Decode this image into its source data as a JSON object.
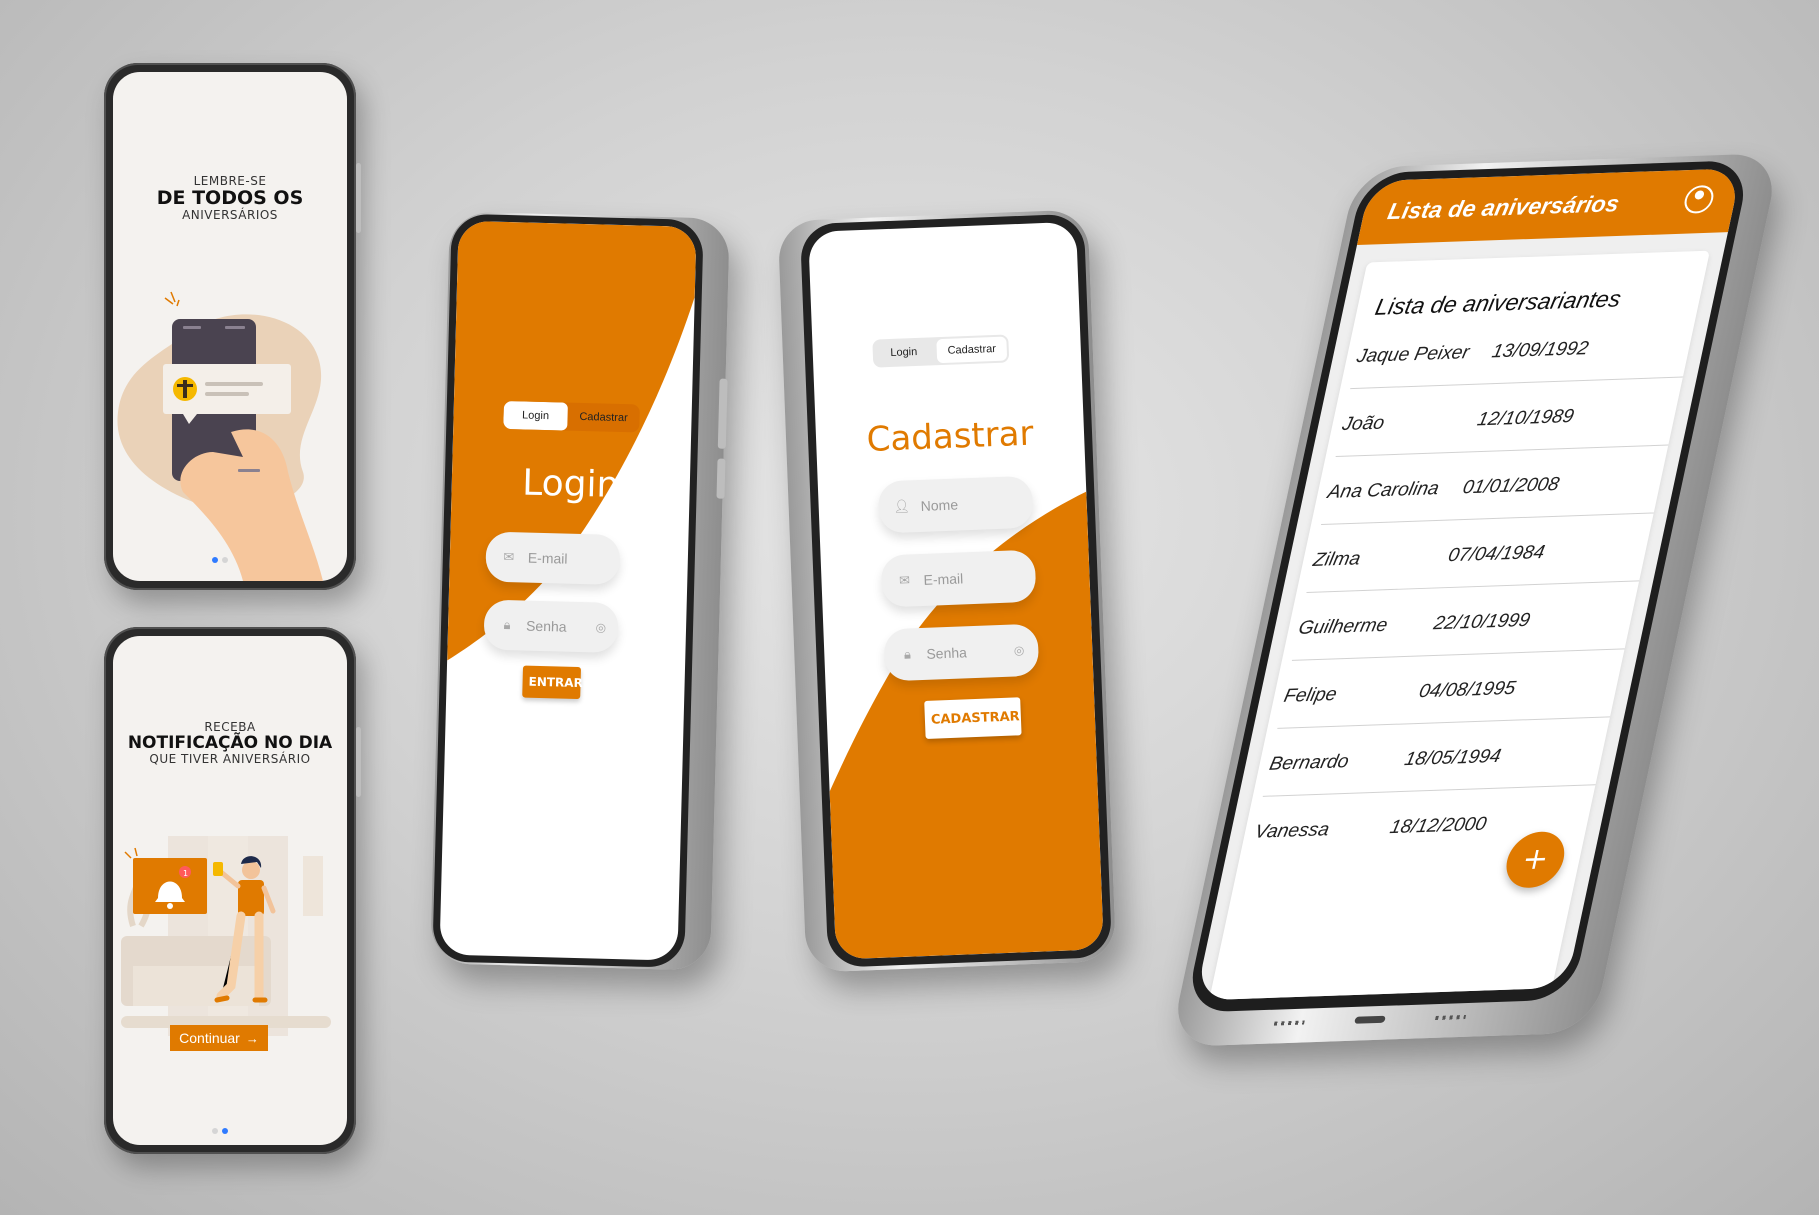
{
  "onboarding1": {
    "line1": "LEMBRE-SE",
    "line2": "DE TODOS OS",
    "line3": "ANIVERSÁRIOS"
  },
  "onboarding2": {
    "line1": "RECEBA",
    "line2": "NOTIFICAÇÃO NO DIA",
    "line3": "QUE TIVER ANIVERSÁRIO",
    "continue_label": "Continuar",
    "badge_count": "1"
  },
  "login_screen": {
    "tab_login": "Login",
    "tab_signup": "Cadastrar",
    "title": "Login",
    "email_placeholder": "E-mail",
    "password_placeholder": "Senha",
    "submit_label": "ENTRAR"
  },
  "signup_screen": {
    "tab_login": "Login",
    "tab_signup": "Cadastrar",
    "title": "Cadastrar",
    "name_placeholder": "Nome",
    "email_placeholder": "E-mail",
    "password_placeholder": "Senha",
    "submit_label": "CADASTRAR"
  },
  "list_screen": {
    "app_title": "Lista de aniversários",
    "card_title": "Lista de aniversariantes",
    "people": [
      {
        "name": "Jaque Peixer",
        "date": "13/09/1992"
      },
      {
        "name": "João",
        "date": "12/10/1989"
      },
      {
        "name": "Ana Carolina",
        "date": "01/01/2008"
      },
      {
        "name": "Zilma",
        "date": "07/04/1984"
      },
      {
        "name": "Guilherme",
        "date": "22/10/1999"
      },
      {
        "name": "Felipe",
        "date": "04/08/1995"
      },
      {
        "name": "Bernardo",
        "date": "18/05/1994"
      },
      {
        "name": "Vanessa",
        "date": "18/12/2000"
      }
    ],
    "fab_label": "+"
  },
  "colors": {
    "accent": "#e07a00",
    "screen_bg": "#f4f2ef",
    "field_bg": "#f0f0f0"
  }
}
